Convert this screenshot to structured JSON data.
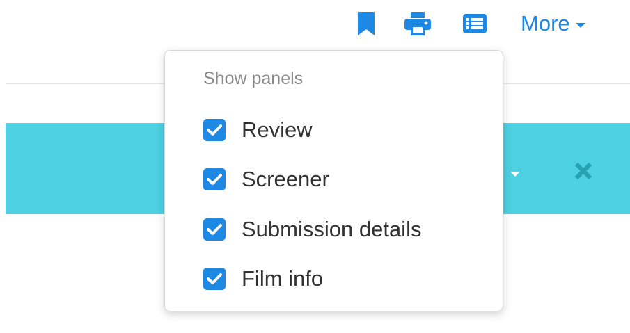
{
  "toolbar": {
    "icons": [
      {
        "name": "bookmark-icon"
      },
      {
        "name": "print-icon"
      },
      {
        "name": "list-icon"
      }
    ],
    "more_label": "More",
    "accent_color": "#1e88e5"
  },
  "banner": {
    "color": "#4dd0e1"
  },
  "dropdown": {
    "header": "Show panels",
    "options": [
      {
        "label": "Review",
        "checked": true
      },
      {
        "label": "Screener",
        "checked": true
      },
      {
        "label": "Submission details",
        "checked": true
      },
      {
        "label": "Film info",
        "checked": true
      }
    ]
  }
}
